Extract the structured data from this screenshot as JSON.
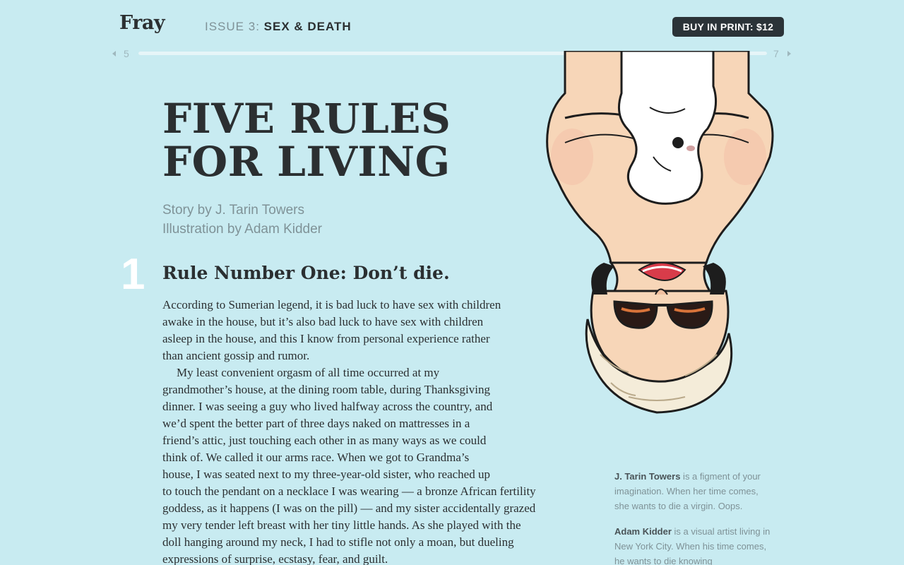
{
  "header": {
    "logo": "Fray",
    "issue_label": "ISSUE 3:",
    "issue_title": "SEX & DEATH",
    "buy_button": "BUY IN PRINT: $12"
  },
  "pager": {
    "prev_page": "5",
    "next_page": "7",
    "progress_percent": 100
  },
  "article": {
    "title_line1": "FIVE RULES",
    "title_line2": "FOR LIVING",
    "story_credit": "Story by J. Tarin Towers",
    "illustration_credit": "Illustration by Adam Kidder",
    "rule_number": "1",
    "rule_heading": "Rule Number One: Don’t die.",
    "body_lines": [
      "According to Sumerian legend, it is bad luck to have sex with children",
      "awake in the house, but it’s also bad luck to have sex with children",
      "asleep in the house, and this I know from personal experience rather",
      "than ancient gossip and rumor.",
      "My least convenient orgasm of all time occurred at my",
      "grandmother’s house, at the dining room table, during Thanksgiving",
      "dinner. I was seeing a guy who lived halfway across the country, and",
      "we’d spent the better part of three days naked on mattresses in a",
      "friend’s attic, just touching each other in as many ways as we could",
      "think of. We called it our arms race. When we got to Grandma’s",
      "house, I was seated next to my three-year-old sister, who reached up",
      "to touch the pendant on a necklace I was wearing — a bronze African fertility",
      "goddess, as it happens (I was on the pill) — and my sister accidentally grazed",
      "my very tender left breast with her tiny little hands. As she played with the",
      "doll hanging around my neck, I had to stifle not only a moan, but dueling",
      "expressions of surprise, ecstasy, fear, and guilt."
    ]
  },
  "bios": {
    "author_name": "J. Tarin Towers",
    "author_bio": " is a figment of your imagination. When her time comes, she wants to die a virgin. Oops.",
    "illustrator_name": "Adam Kidder",
    "illustrator_bio": " is a visual artist living in New York City. When his time comes, he wants to die knowing"
  },
  "colors": {
    "background": "#c8ebf1",
    "text": "#2b2f31",
    "muted": "#7f9297",
    "button": "#2b3338",
    "skin": "#f7d6b8",
    "hair": "#f4ecd9"
  }
}
